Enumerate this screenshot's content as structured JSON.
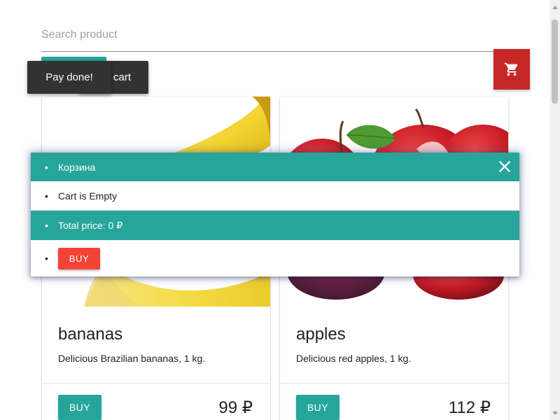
{
  "search": {
    "placeholder": "Search product"
  },
  "cart_fab": {
    "icon": "shopping-cart-icon",
    "color": "#c62828"
  },
  "toasts": {
    "cart_text": "cart",
    "pay_text": "Pay done!"
  },
  "products": [
    {
      "title": "bananas",
      "description": "Delicious Brazilian bananas, 1 kg.",
      "buy_label": "BUY",
      "price": "99 ₽"
    },
    {
      "title": "apples",
      "description": "Delicious red apples, 1 kg.",
      "buy_label": "BUY",
      "price": "112 ₽"
    }
  ],
  "cart_popup": {
    "header": "Корзина",
    "empty_text": "Cart is Empty",
    "total_text": "Total price: 0 ₽",
    "buy_label": "BUY",
    "bullet": "•"
  },
  "colors": {
    "accent": "#26a69a",
    "danger": "#f44336",
    "cart": "#c62828",
    "toast": "#323232"
  }
}
